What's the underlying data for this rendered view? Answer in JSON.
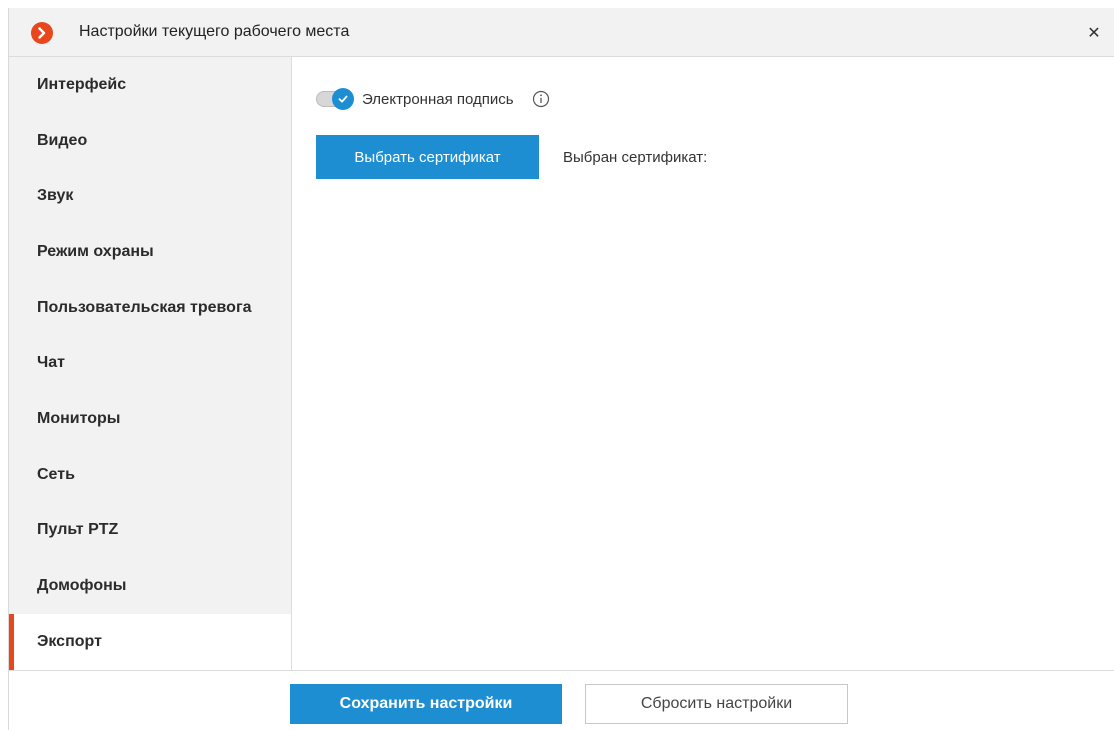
{
  "window": {
    "title": "Настройки текущего рабочего места",
    "logo_icon": "app-logo-icon",
    "close_icon": "close-icon",
    "close_glyph": "✕"
  },
  "sidebar": {
    "items": [
      {
        "label": "Интерфейс"
      },
      {
        "label": "Видео"
      },
      {
        "label": "Звук"
      },
      {
        "label": "Режим охраны"
      },
      {
        "label": "Пользовательская тревога"
      },
      {
        "label": "Чат"
      },
      {
        "label": "Мониторы"
      },
      {
        "label": "Сеть"
      },
      {
        "label": "Пульт PTZ"
      },
      {
        "label": "Домофоны"
      },
      {
        "label": "Экспорт",
        "active": true
      }
    ]
  },
  "content": {
    "signature_toggle": {
      "label": "Электронная подпись",
      "checked": true,
      "info_icon": "info-icon"
    },
    "choose_certificate_button": "Выбрать сертификат",
    "selected_certificate_label": "Выбран сертификат:"
  },
  "footer": {
    "save_label": "Сохранить настройки",
    "reset_label": "Сбросить настройки"
  },
  "colors": {
    "accent": "#1e8ed3",
    "brand": "#e8461c",
    "sidebar_bg": "#f2f2f2"
  }
}
